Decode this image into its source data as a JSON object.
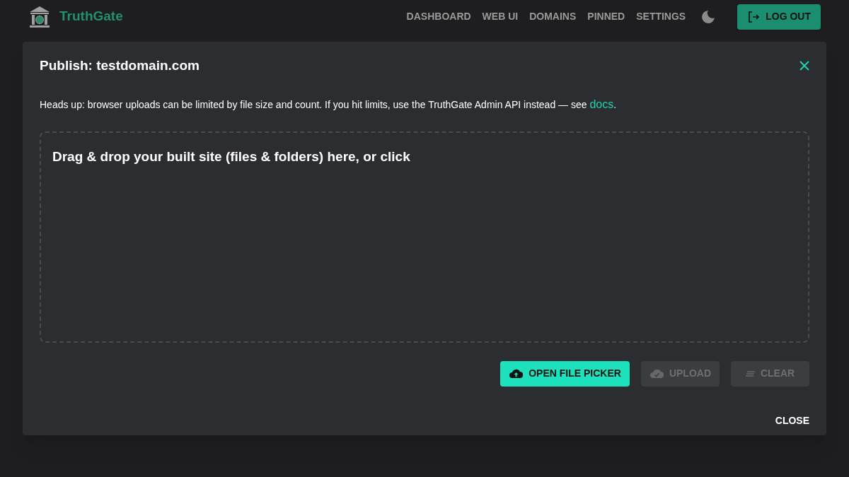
{
  "app": {
    "name": "TruthGate"
  },
  "nav": [
    {
      "label": "DASHBOARD"
    },
    {
      "label": "WEB UI"
    },
    {
      "label": "DOMAINS"
    },
    {
      "label": "PINNED"
    },
    {
      "label": "SETTINGS"
    }
  ],
  "logout_button": {
    "label": "LOG OUT"
  },
  "dialog": {
    "title": "Publish: testdomain.com",
    "notice": {
      "text": "Heads up: browser uploads can be limited by file size and count. If you hit limits, use the TruthGate Admin API instead — see ",
      "link": "docs",
      "end": "."
    },
    "dropzone": {
      "text": "Drag & drop your built site (files & folders) here, or click"
    },
    "actions": [
      {
        "kind": "pick",
        "label": "OPEN FILE PICKER",
        "disabled": false
      },
      {
        "kind": "upload",
        "label": "UPLOAD",
        "disabled": true
      },
      {
        "kind": "clear",
        "label": "CLEAR",
        "disabled": true
      }
    ],
    "close_button": {
      "label": "CLOSE"
    }
  }
}
